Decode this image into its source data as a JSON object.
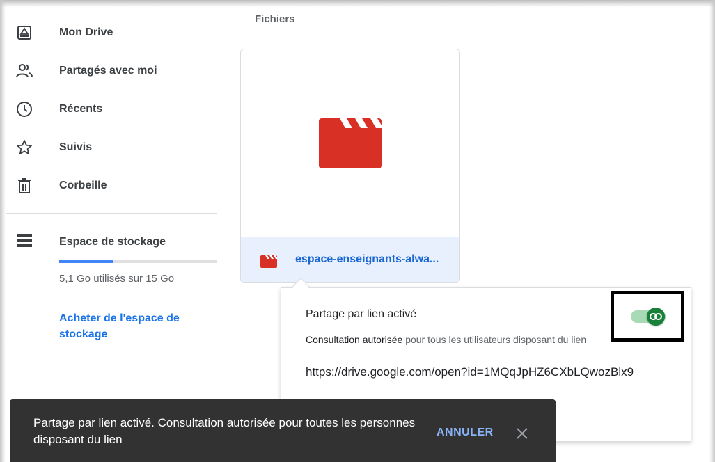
{
  "sidebar": {
    "items": [
      {
        "label": "Mon Drive",
        "icon": "drive-icon"
      },
      {
        "label": "Partagés avec moi",
        "icon": "shared-users-icon"
      },
      {
        "label": "Récents",
        "icon": "clock-icon"
      },
      {
        "label": "Suivis",
        "icon": "star-icon"
      },
      {
        "label": "Corbeille",
        "icon": "trash-icon"
      }
    ],
    "storage": {
      "label": "Espace de stockage",
      "usage_text": "5,1 Go utilisés sur 15 Go",
      "used_fraction": 0.34,
      "buy_label": "Acheter de l'espace de stockage"
    }
  },
  "main": {
    "section_title": "Fichiers",
    "file": {
      "name": "espace-enseignants-alwa...",
      "icon": "video-file-icon",
      "icon_color": "#d93025"
    }
  },
  "share_popup": {
    "title": "Partage par lien activé",
    "desc_bold": "Consultation autorisée",
    "desc_rest": " pour tous les utilisateurs disposant du lien",
    "url": "https://drive.google.com/open?id=1MQqJpHZ6CXbLQwozBlx9",
    "toggle_on": true,
    "toggle_color": "#188038"
  },
  "snackbar": {
    "message": "Partage par lien activé. Consultation autorisée pour toutes les personnes disposant du lien",
    "action_label": "ANNULER"
  }
}
